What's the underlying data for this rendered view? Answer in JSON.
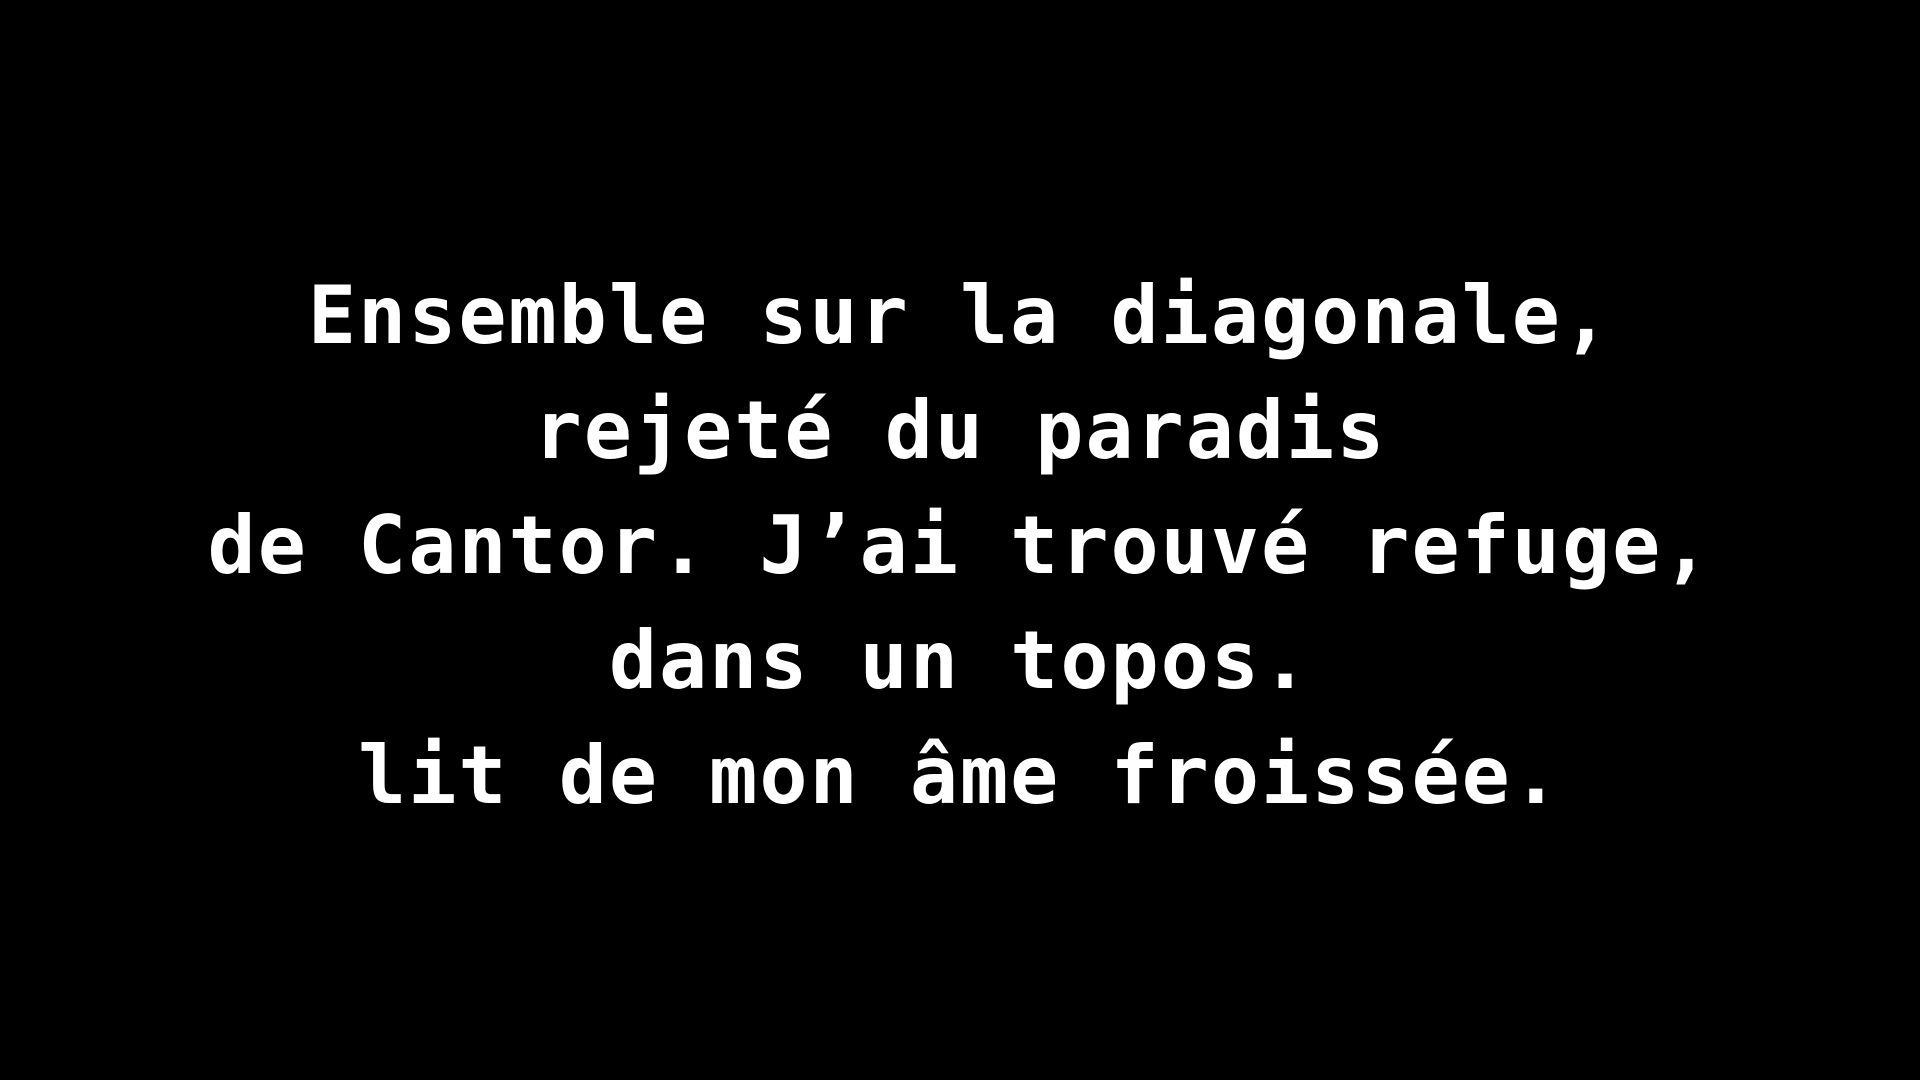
{
  "background_color": "#000000",
  "text_color": "#ffffff",
  "poem": {
    "lines": [
      "Ensemble sur la diagonale,",
      "rejeté du paradis",
      "de Cantor. J’ai trouvé refuge,",
      "dans un topos.",
      "lit de mon âme froissée."
    ]
  }
}
